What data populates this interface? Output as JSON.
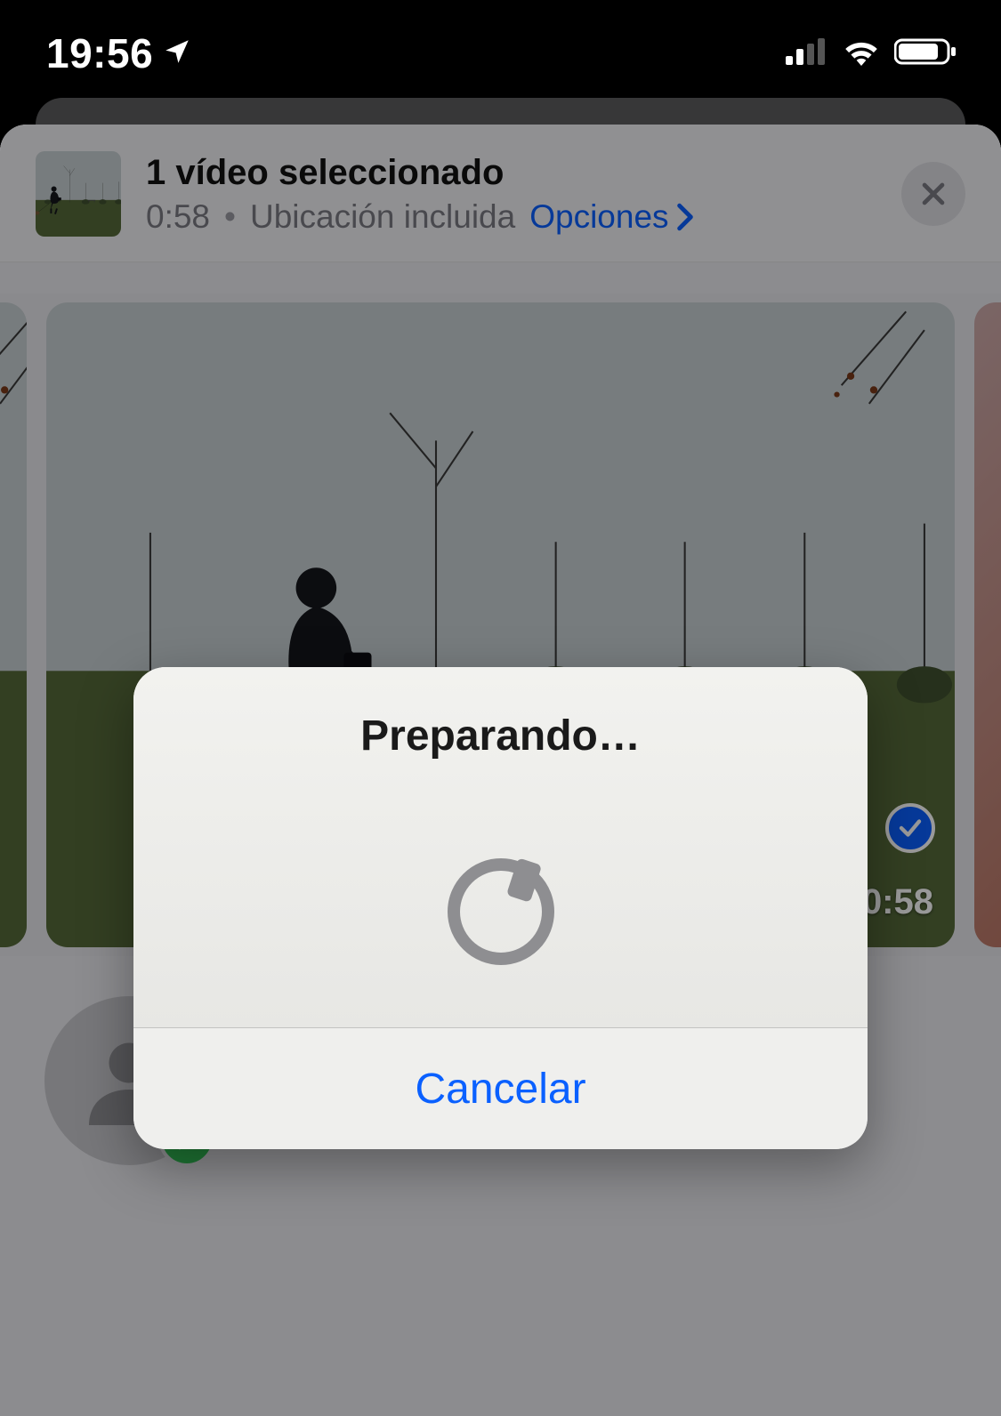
{
  "status_bar": {
    "time": "19:56",
    "location_arrow": true,
    "cellular_bars": 2,
    "wifi": true,
    "battery_pct_visual": 78
  },
  "share_sheet": {
    "header": {
      "title": "1 vídeo seleccionado",
      "duration": "0:58",
      "location_text": "Ubicación incluida",
      "options_label": "Opciones"
    },
    "preview": {
      "selected": true,
      "duration_overlay": "0:58"
    }
  },
  "alert": {
    "title": "Preparando…",
    "cancel_label": "Cancelar"
  }
}
